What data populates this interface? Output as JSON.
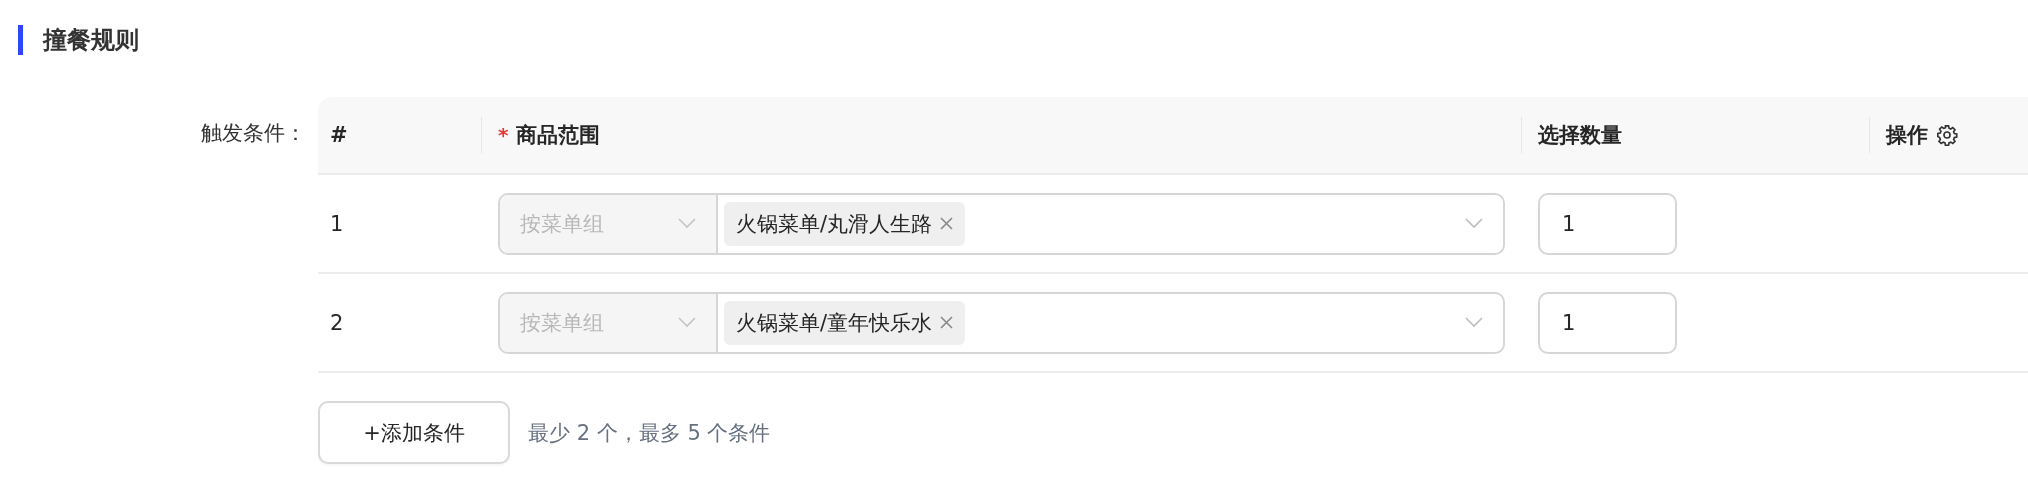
{
  "section": {
    "title": "撞餐规则"
  },
  "field": {
    "label": "触发条件："
  },
  "columns": [
    {
      "label": "#"
    },
    {
      "label": "商品范围",
      "required_mark": "*"
    },
    {
      "label": "选择数量"
    },
    {
      "label": "操作",
      "kind": "settings"
    }
  ],
  "rows": [
    {
      "index": "1",
      "group_select": {
        "value": "按菜单组",
        "disabled": true
      },
      "tags": [
        "火锅菜单/丸滑人生路"
      ],
      "quantity": "1"
    },
    {
      "index": "2",
      "group_select": {
        "value": "按菜单组",
        "disabled": true
      },
      "tags": [
        "火锅菜单/童年快乐水"
      ],
      "quantity": "1"
    }
  ],
  "add_button": "+添加条件",
  "hint": "最少 2 个，最多 5 个条件"
}
